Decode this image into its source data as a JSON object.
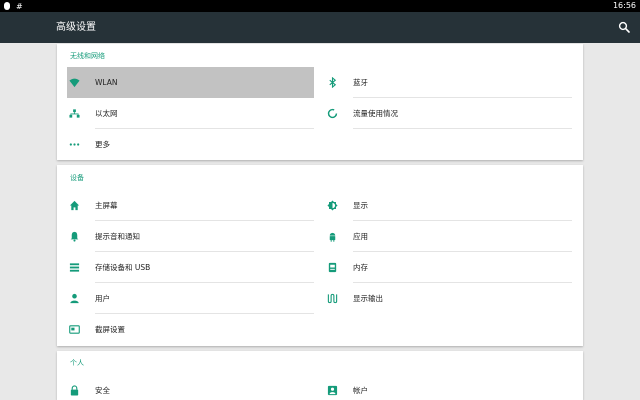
{
  "statusbar": {
    "left_symbol": "#",
    "time": "16:56"
  },
  "appbar": {
    "title": "高级设置"
  },
  "sections": {
    "network": {
      "title": "无线和网络",
      "items": {
        "wlan": "WLAN",
        "bluetooth": "蓝牙",
        "ethernet": "以太网",
        "data_usage": "流量使用情况",
        "more": "更多"
      }
    },
    "device": {
      "title": "设备",
      "items": {
        "home": "主屏幕",
        "display": "显示",
        "sound": "提示音和通知",
        "apps": "应用",
        "storage": "存储设备和 USB",
        "memory": "内存",
        "users": "用户",
        "display_output": "显示输出",
        "screenshot": "截屏设置"
      }
    },
    "personal": {
      "title": "个人",
      "items": {
        "security": "安全",
        "accounts": "帐户"
      }
    }
  },
  "colors": {
    "accent": "#159b7a",
    "appbar": "#263238",
    "selected": "#c2c2c2"
  }
}
